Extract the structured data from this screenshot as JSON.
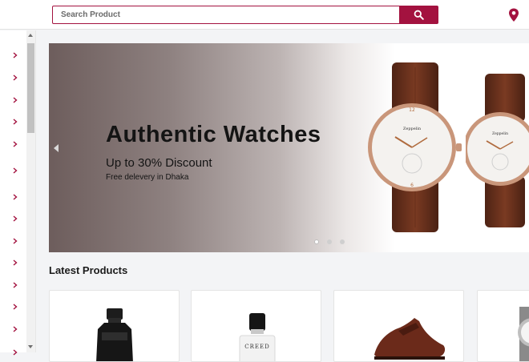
{
  "header": {
    "search_placeholder": "Search Product",
    "search_icon": "search-icon",
    "location_icon": "location-pin-icon",
    "brand_color": "#a3123f"
  },
  "sidebar": {
    "item_icon": "chevron-right-icon",
    "item_count": 14
  },
  "banner": {
    "title": "Authentic Watches",
    "subtitle": "Up to 30% Discount",
    "note": "Free delevery in Dhaka",
    "slide_count": 3,
    "active_slide": 1
  },
  "latest": {
    "title": "Latest Products",
    "products": [
      {
        "image": "perfume-bottle-black"
      },
      {
        "image": "perfume-bottle-creed"
      },
      {
        "image": "leather-shoe"
      },
      {
        "image": "wrist-watch"
      }
    ],
    "product_label_creed": "CREED"
  }
}
